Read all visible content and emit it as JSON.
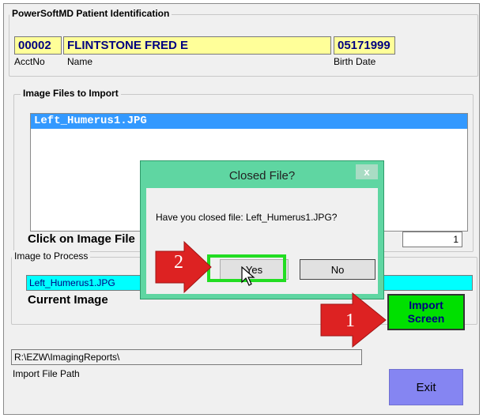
{
  "patient_group": {
    "legend": "PowerSoftMD Patient Identification",
    "acct_no": "00002",
    "name": "FLINTSTONE FRED E",
    "birth_date": "05171999",
    "acct_caption": "AcctNo",
    "name_caption": "Name",
    "birth_caption": "Birth Date"
  },
  "import_group": {
    "legend": "Image Files to Import",
    "files": [
      "Left_Humerus1.JPG"
    ],
    "click_label": "Click on Image File",
    "count": "1"
  },
  "process_group": {
    "legend": "Image to Process",
    "current_file": "Left_Humerus1.JPG",
    "current_label": "Current Image"
  },
  "buttons": {
    "import_line1": "Import",
    "import_line2": "Screen",
    "exit": "Exit"
  },
  "path": {
    "value": "R:\\EZW\\ImagingReports\\",
    "caption": "Import File Path"
  },
  "dialog": {
    "title": "Closed File?",
    "close_glyph": "x",
    "message": "Have you closed file: Left_Humerus1.JPG?",
    "yes": "Yes",
    "no": "No"
  },
  "annotations": {
    "step1": "1",
    "step2": "2",
    "arrow_color": "#dd2222",
    "highlight_color": "#22dd22"
  }
}
